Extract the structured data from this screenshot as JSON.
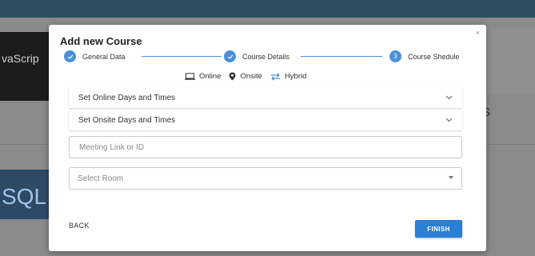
{
  "background": {
    "card_left_text": "vaScrip",
    "card_sql_text": "SQL",
    "right_text": "S"
  },
  "modal": {
    "title": "Add new Course",
    "close": "×"
  },
  "stepper": [
    {
      "label": "General Data",
      "state": "done",
      "icon": "check-icon"
    },
    {
      "label": "Course Details",
      "state": "done",
      "icon": "check-icon"
    },
    {
      "label": "Course Shedule",
      "state": "active",
      "number": "3"
    }
  ],
  "modes": [
    {
      "label": "Online",
      "icon": "laptop-icon"
    },
    {
      "label": "Onsite",
      "icon": "location-pin-icon"
    },
    {
      "label": "Hybrid",
      "icon": "swap-arrows-icon"
    }
  ],
  "sections": {
    "online": "Set Online Days and Times",
    "onsite": "Set Onsite Days and Times"
  },
  "inputs": {
    "meeting_link_placeholder": "Meeting Link or ID",
    "room_placeholder": "Select Room"
  },
  "buttons": {
    "back": "BACK",
    "finish": "FINISH"
  },
  "colors": {
    "accent": "#2b7fd4",
    "step": "#4a90d9",
    "topbar": "#2e4f5f"
  }
}
